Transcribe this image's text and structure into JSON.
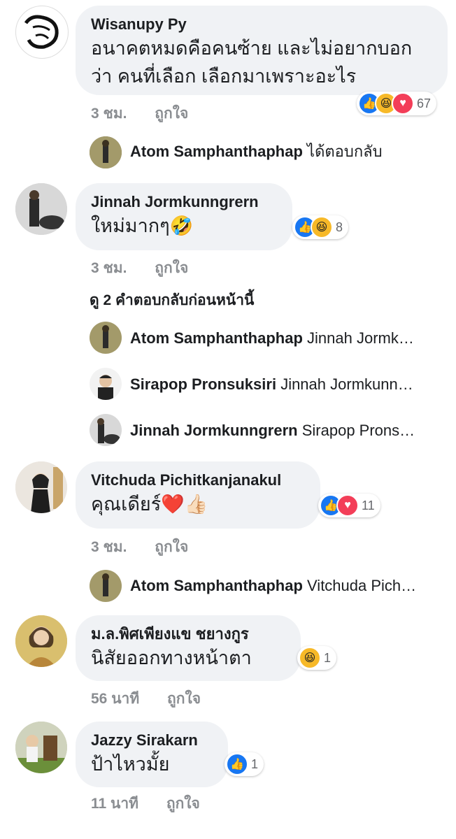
{
  "colors": {
    "bubble_bg": "#f0f2f5",
    "like_blue": "#1877f2",
    "haha_yellow": "#f7b928",
    "love_red": "#f33e58",
    "meta_grey": "#8a8d91"
  },
  "comments": [
    {
      "author": "Wisanupy Py",
      "text_lines": [
        "อนาคตหมดคือคนซ้าย และไม่อยากบอก",
        "ว่า คนที่เลือก เลือกมาเพราะอะไร"
      ],
      "reactions": [
        "like-icon",
        "haha-icon",
        "love-icon"
      ],
      "reaction_count": "67",
      "time": "3 ชม.",
      "like_label": "ถูกใจ",
      "replies": [
        {
          "author": "Atom Samphanthaphap",
          "text": "ได้ตอบกลับ"
        }
      ]
    },
    {
      "author": "Jinnah Jormkunngrern",
      "text": "ใหม่มากๆ🤣",
      "reactions": [
        "like-icon",
        "haha-icon"
      ],
      "reaction_count": "8",
      "time": "3 ชม.",
      "like_label": "ถูกใจ",
      "view_more": "ดู 2 คำตอบกลับก่อนหน้านี้",
      "replies": [
        {
          "author": "Atom Samphanthaphap",
          "text": "Jinnah Jormk…"
        },
        {
          "author": "Sirapop Pronsuksiri",
          "text": "Jinnah Jormkunn…"
        },
        {
          "author": "Jinnah Jormkunngrern",
          "text": "Sirapop Prons…"
        }
      ]
    },
    {
      "author": "Vitchuda Pichitkanjanakul",
      "text": "คุณเดียร์❤️👍🏻",
      "reactions": [
        "like-icon",
        "love-icon"
      ],
      "reaction_count": "11",
      "time": "3 ชม.",
      "like_label": "ถูกใจ",
      "replies": [
        {
          "author": "Atom Samphanthaphap",
          "text": "Vitchuda Pich…"
        }
      ]
    },
    {
      "author": "ม.ล.พิศเพียงแข ชยางกูร",
      "text": "นิสัยออกทางหน้าตา",
      "reactions": [
        "haha-icon"
      ],
      "reaction_count": "1",
      "time": "56 นาที",
      "like_label": "ถูกใจ"
    },
    {
      "author": "Jazzy Sirakarn",
      "text": "ป้าไหวมั้ย",
      "reactions": [
        "like-icon"
      ],
      "reaction_count": "1",
      "time": "11 นาที",
      "like_label": "ถูกใจ"
    }
  ]
}
